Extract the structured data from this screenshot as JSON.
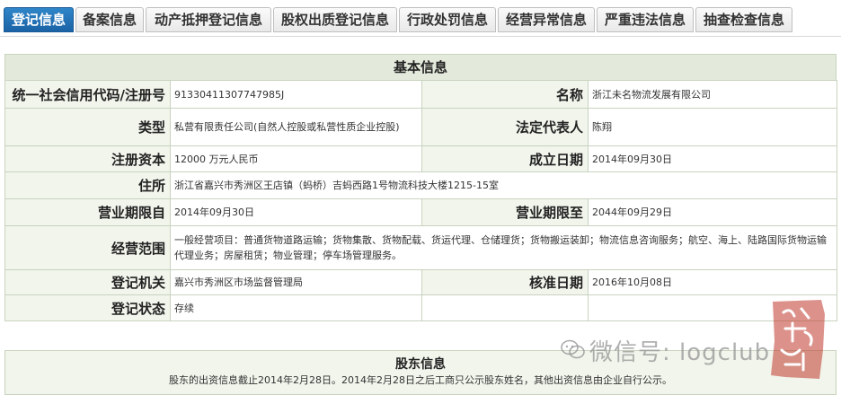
{
  "tabs": [
    {
      "label": "登记信息",
      "active": true
    },
    {
      "label": "备案信息",
      "active": false
    },
    {
      "label": "动产抵押登记信息",
      "active": false
    },
    {
      "label": "股权出质登记信息",
      "active": false
    },
    {
      "label": "行政处罚信息",
      "active": false
    },
    {
      "label": "经营异常信息",
      "active": false
    },
    {
      "label": "严重违法信息",
      "active": false
    },
    {
      "label": "抽查检查信息",
      "active": false
    }
  ],
  "basic": {
    "title": "基本信息",
    "credit_code_label": "统一社会信用代码/注册号",
    "credit_code": "91330411307747985J",
    "name_label": "名称",
    "name": "浙江未名物流发展有限公司",
    "type_label": "类型",
    "type": "私营有限责任公司(自然人控股或私营性质企业控股)",
    "legal_rep_label": "法定代表人",
    "legal_rep": "陈翔",
    "capital_label": "注册资本",
    "capital": "12000 万元人民币",
    "established_label": "成立日期",
    "established": "2014年09月30日",
    "address_label": "住所",
    "address": "浙江省嘉兴市秀洲区王店镇（蚂桥）吉蚂西路1号物流科技大楼1215-15室",
    "period_from_label": "营业期限自",
    "period_from": "2014年09月30日",
    "period_to_label": "营业期限至",
    "period_to": "2044年09月29日",
    "scope_label": "经营范围",
    "scope": "一般经营项目：普通货物道路运输；货物集散、货物配载、货运代理、仓储理货；货物搬运装卸；物流信息咨询服务；航空、海上、陆路国际货物运输代理业务；房屋租赁；物业管理；停车场管理服务。",
    "authority_label": "登记机关",
    "authority": "嘉兴市秀洲区市场监督管理局",
    "approval_label": "核准日期",
    "approval": "2016年10月08日",
    "status_label": "登记状态",
    "status": "存续"
  },
  "shareholders": {
    "title": "股东信息",
    "note": "股东的出资信息截止2014年2月28日。2014年2月28日之后工商只公示股东姓名，其他出资信息由企业自行公示。"
  },
  "watermark": {
    "text": "微信号: logclub",
    "icon": "wechat-icon"
  },
  "seal": {
    "icon": "red-seal-icon",
    "color": "#c0392b"
  },
  "colors": {
    "active_tab": "#1f6fb5",
    "section_header": "#e3eadc",
    "label_bg": "#f1f5ec",
    "border": "#c9d3bf"
  }
}
